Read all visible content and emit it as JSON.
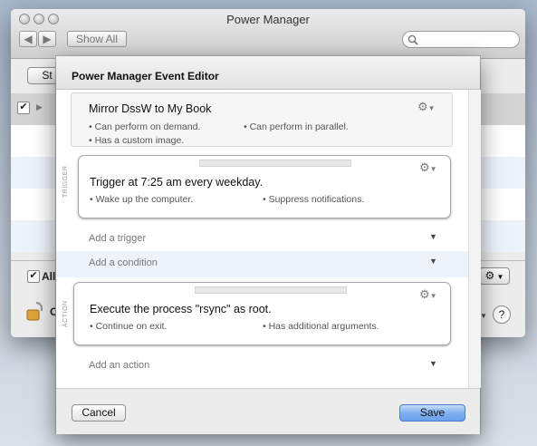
{
  "window": {
    "title": "Power Manager",
    "show_all_label": "Show All",
    "search_placeholder": "",
    "partial_button": "St",
    "checkbox_partial_label": "All",
    "bottom_partial_label": "C"
  },
  "sheet": {
    "title": "Power Manager Event Editor",
    "summary": {
      "title": "Mirror DssW to My Book",
      "bullets": [
        "Can perform on demand.",
        "Can perform in parallel.",
        "Has a custom image."
      ]
    },
    "trigger_section": {
      "side_label": "TRIGGER",
      "card": {
        "title": "Trigger at 7:25 am every weekday.",
        "bullets": [
          "Wake up the computer.",
          "Suppress notifications."
        ]
      },
      "add_trigger": "Add a trigger"
    },
    "condition_section": {
      "add_condition": "Add a condition"
    },
    "action_section": {
      "side_label": "ACTION",
      "card": {
        "title": "Execute the process \"rsync\" as root.",
        "bullets": [
          "Continue on exit.",
          "Has additional arguments."
        ]
      },
      "add_action": "Add an action"
    },
    "cancel_label": "Cancel",
    "save_label": "Save"
  },
  "colors": {
    "accent": "#6aa1eb",
    "row_alt": "#eef3fb",
    "selected_row": "#d4d4d4"
  },
  "icons": {
    "gear": "gear-icon",
    "dropdown": "chevron-down-icon",
    "lock": "lock-icon",
    "help": "help-icon",
    "search": "search-icon"
  }
}
